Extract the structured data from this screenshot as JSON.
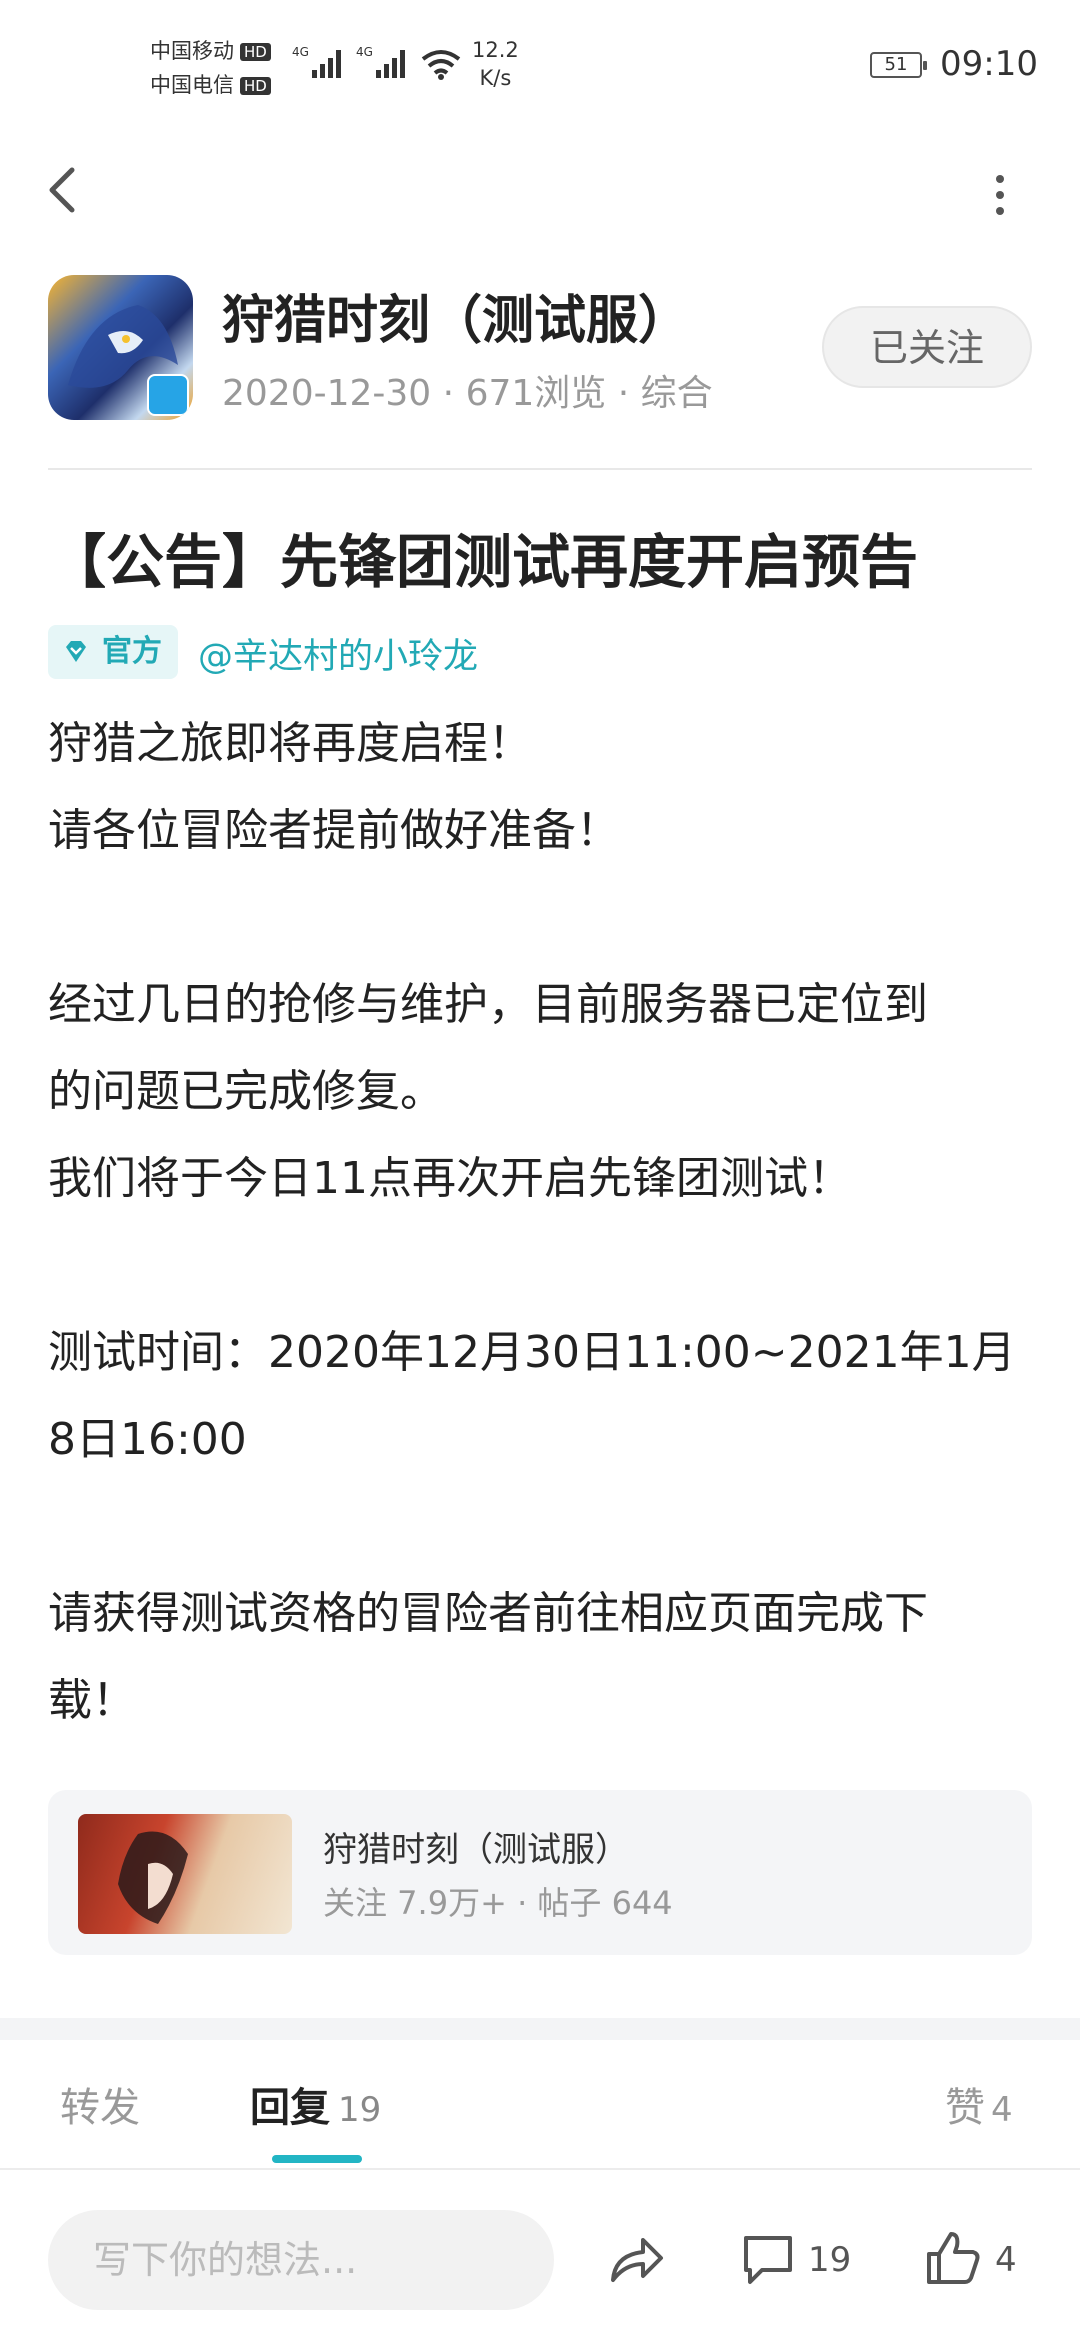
{
  "status_bar": {
    "carrier1": "中国移动",
    "carrier2": "中国电信",
    "hd": "HD",
    "network1": "4G",
    "network2": "4G",
    "speed_value": "12.2",
    "speed_unit": "K/s",
    "battery": "51",
    "time": "09:10"
  },
  "header": {
    "game_name": "狩猎时刻（测试服）",
    "date": "2020-12-30",
    "views": "671浏览",
    "category": "综合",
    "follow_label": "已关注"
  },
  "post": {
    "title": "【公告】先锋团测试再度开启预告",
    "official_badge": "官方",
    "author": "@辛达村的小玲龙",
    "lines": [
      "狩猎之旅即将再度启程！",
      "请各位冒险者提前做好准备！",
      "",
      "经过几日的抢修与维护，目前服务器已定位到",
      "的问题已完成修复。",
      "我们将于今日11点再次开启先锋团测试！",
      "",
      "测试时间：2020年12月30日11:00~2021年1月",
      "8日16:00",
      "",
      "请获得测试资格的冒险者前往相应页面完成下",
      "载！"
    ]
  },
  "linked_card": {
    "title": "狩猎时刻（测试服）",
    "followers": "关注 7.9万+",
    "posts": "帖子 644"
  },
  "tabs": {
    "forward": "转发",
    "reply": "回复",
    "reply_count": "19",
    "like": "赞",
    "like_count": "4"
  },
  "bottom_bar": {
    "input_placeholder": "写下你的想法...",
    "comment_count": "19",
    "like_count": "4"
  },
  "colors": {
    "accent": "#22b5c4",
    "official_text": "#22a9b5"
  },
  "icons": [
    "back-icon",
    "more-icon",
    "wifi-icon",
    "signal-icon",
    "share-icon",
    "comment-icon",
    "thumbs-up-icon",
    "diamond-icon"
  ]
}
